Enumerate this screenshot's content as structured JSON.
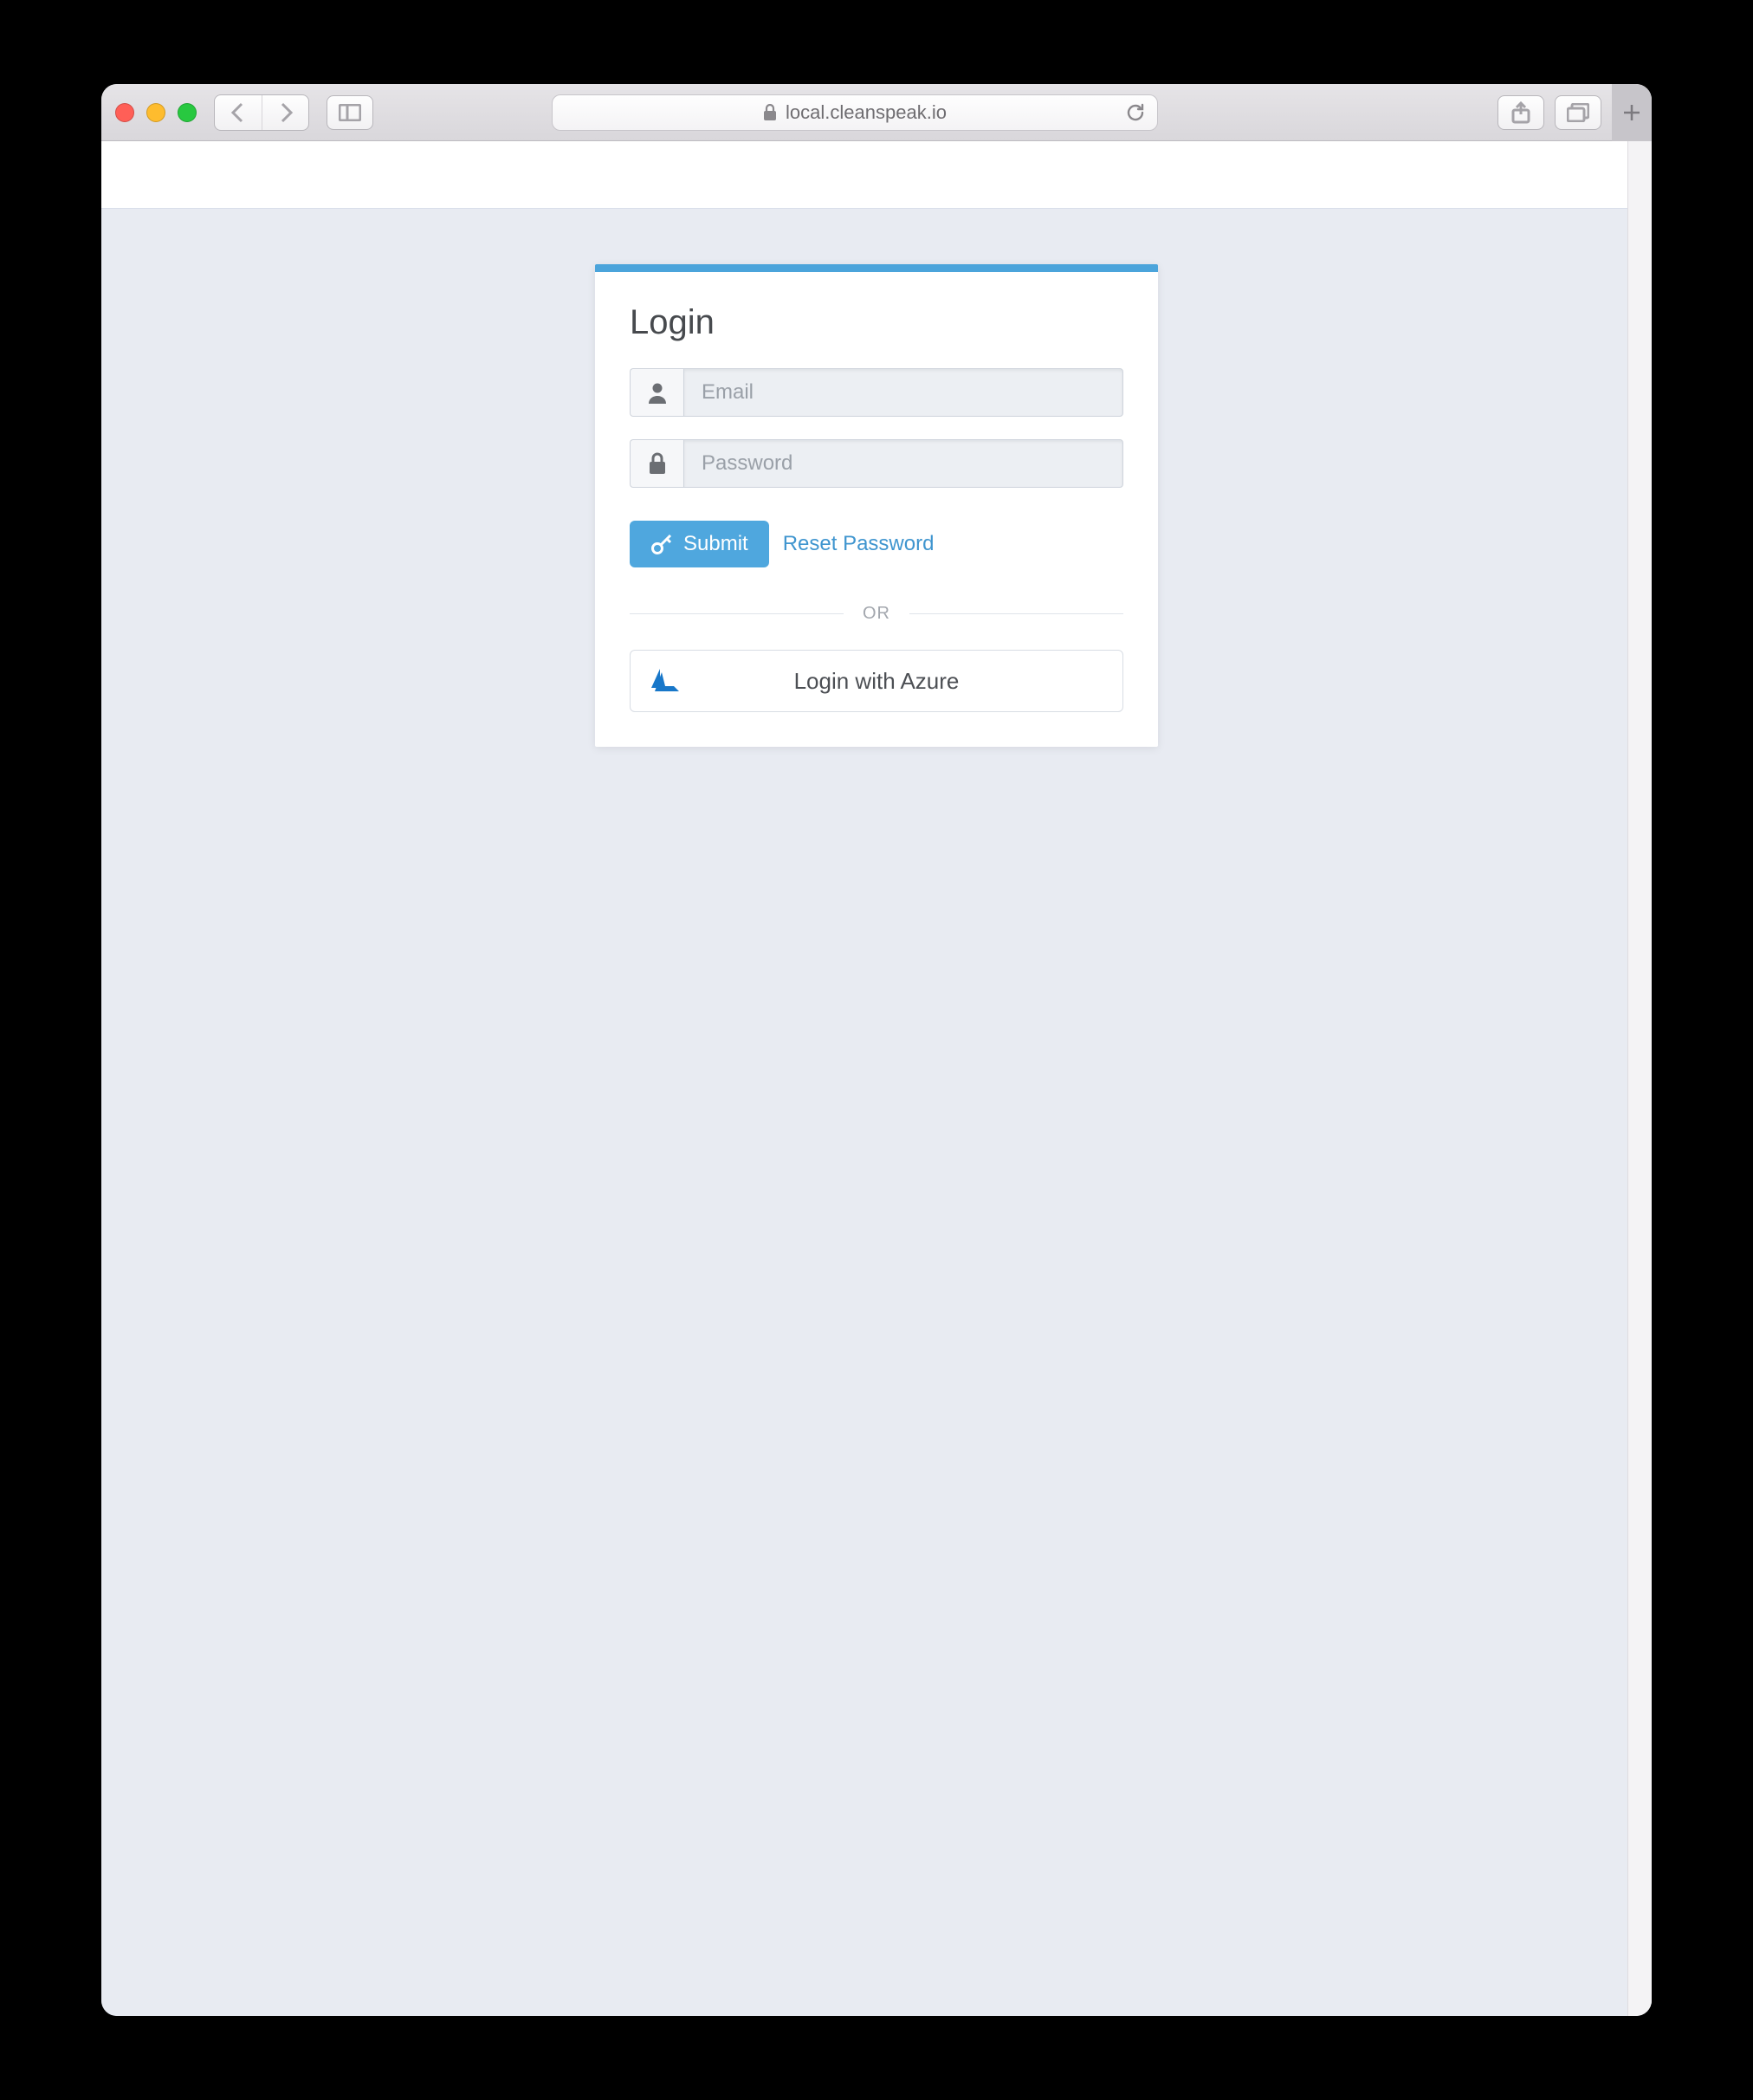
{
  "browser": {
    "url_display": "local.cleanspeak.io"
  },
  "login": {
    "title": "Login",
    "email_placeholder": "Email",
    "password_placeholder": "Password",
    "submit_label": "Submit",
    "reset_label": "Reset Password",
    "divider_label": "OR",
    "oauth_label": "Login with Azure"
  }
}
